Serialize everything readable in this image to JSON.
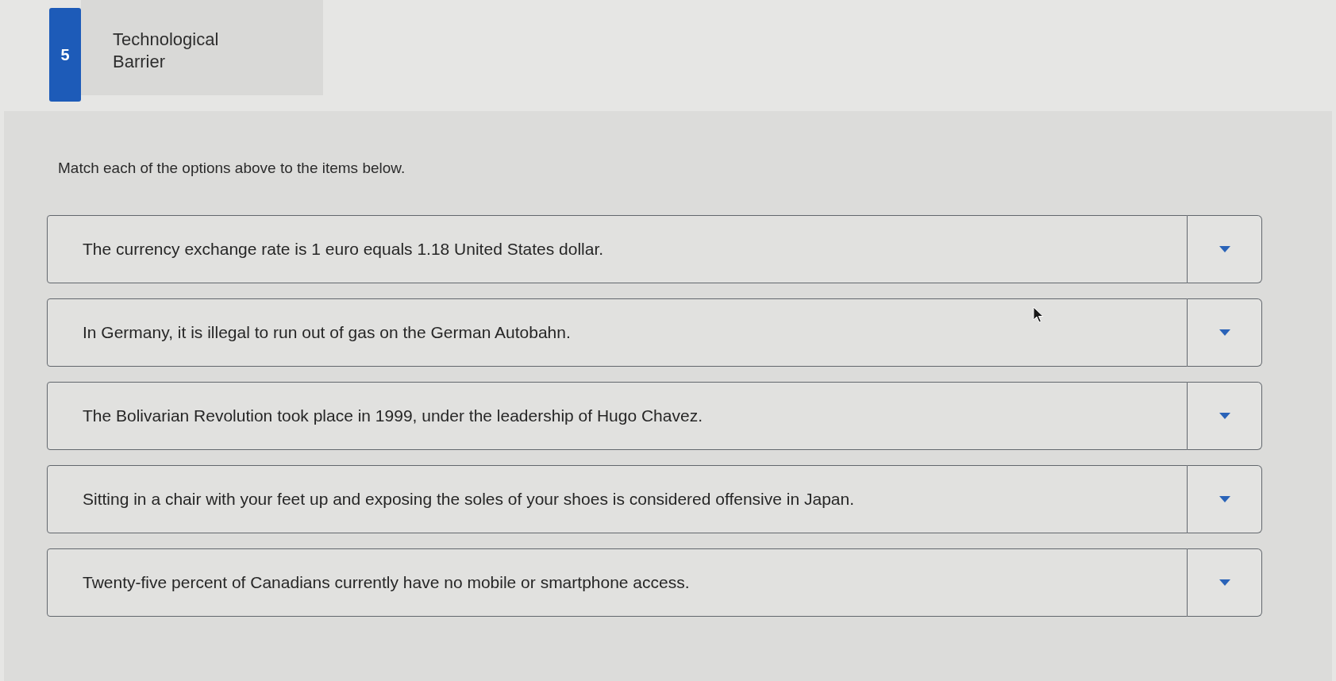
{
  "question": {
    "number": "5"
  },
  "option_card": {
    "label": "Technological Barrier"
  },
  "instruction": "Match each of the options above to the items below.",
  "items": [
    {
      "text": "The currency exchange rate is 1 euro equals 1.18 United States dollar."
    },
    {
      "text": "In Germany, it is illegal to run out of gas on the German Autobahn."
    },
    {
      "text": "The Bolivarian Revolution took place in 1999, under the leadership of Hugo Chavez."
    },
    {
      "text": "Sitting in a chair with your feet up and exposing the soles of your shoes is considered offensive in Japan."
    },
    {
      "text": "Twenty-five percent of Canadians currently have no mobile or smartphone access."
    }
  ]
}
